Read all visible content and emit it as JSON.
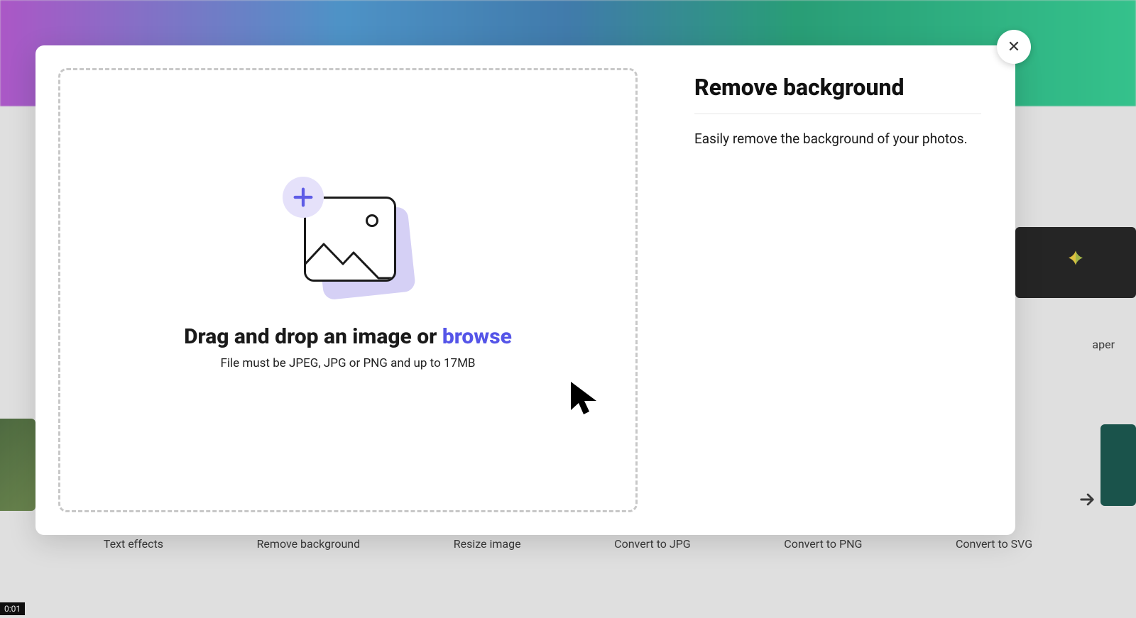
{
  "background": {
    "label_right": "aper",
    "actions": [
      "Text effects",
      "Remove background",
      "Resize image",
      "Convert to JPG",
      "Convert to PNG",
      "Convert to SVG"
    ],
    "timecode": "0:01"
  },
  "modal": {
    "drop": {
      "title_prefix": "Drag and drop an image or ",
      "browse_label": "browse",
      "subtext": "File must be JPEG, JPG or PNG and up to 17MB"
    },
    "side": {
      "title": "Remove background",
      "description": "Easily remove the background of your photos."
    },
    "close_label": "✕"
  }
}
